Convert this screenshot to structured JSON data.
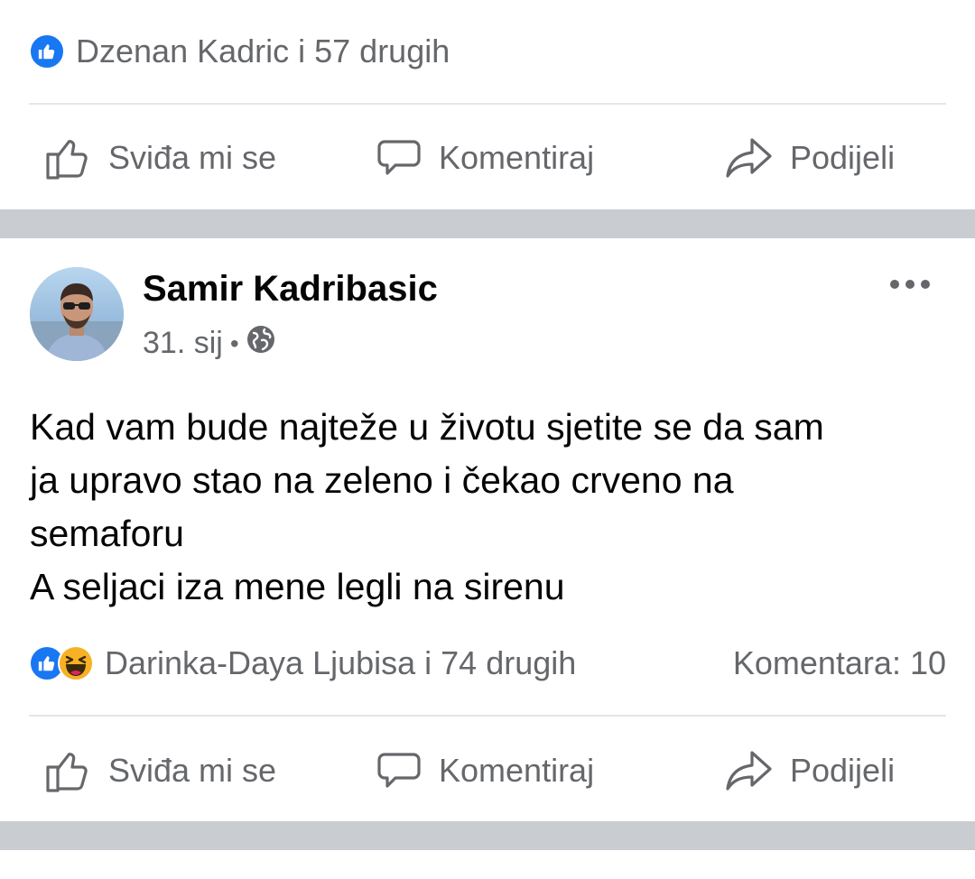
{
  "post1": {
    "reactions_text": "Dzenan Kadric i 57 drugih",
    "actions": {
      "like_label": "Sviđa mi se",
      "comment_label": "Komentiraj",
      "share_label": "Podijeli"
    }
  },
  "post2": {
    "author": "Samir Kadribasic",
    "date": "31. sij",
    "date_separator": "•",
    "privacy_icon": "globe-icon",
    "more_icon": "more-options-icon",
    "text": "Kad vam bude najteže u životu sjetite se da sam\nja upravo stao na zeleno i čekao crveno na\nsemaforu\nA seljaci iza mene legli na sirenu",
    "reaction_icons": [
      "like-reaction-icon",
      "haha-reaction-icon"
    ],
    "reactions_text": "Darinka-Daya Ljubisa i 74 drugih",
    "comments_text": "Komentara: 10",
    "actions": {
      "like_label": "Sviđa mi se",
      "comment_label": "Komentiraj",
      "share_label": "Podijeli"
    }
  },
  "colors": {
    "brand_blue": "#1877f2",
    "secondary_text": "#65676b",
    "divider_band": "#c9ccd1",
    "haha_yellow": "#f7b125"
  }
}
